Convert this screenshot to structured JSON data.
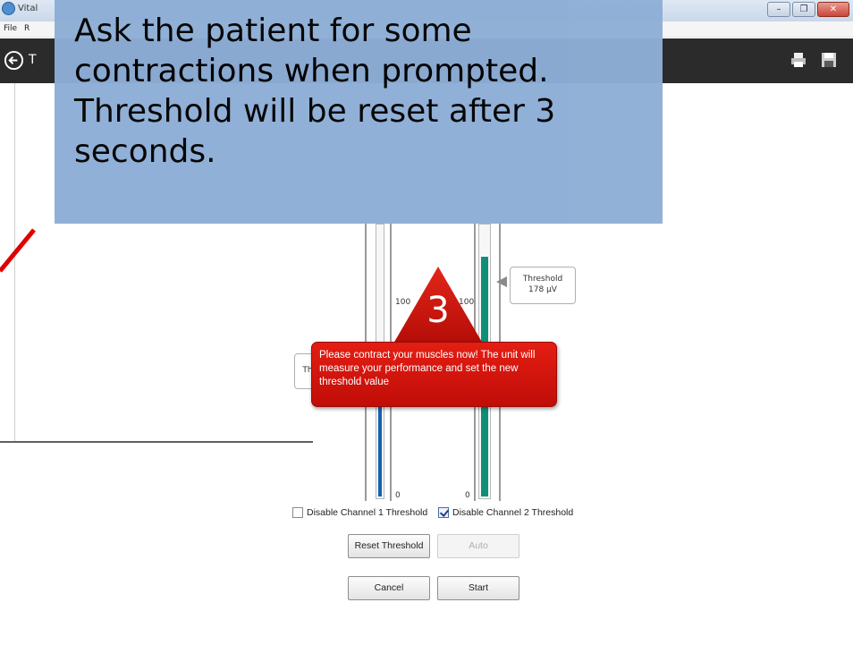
{
  "window": {
    "title": "Vital",
    "minimize": "–",
    "restore": "❐",
    "close": "✕"
  },
  "menu": {
    "file": "File",
    "second": "R"
  },
  "toolbar": {
    "title_fragment": "T"
  },
  "instruction": {
    "text": "Ask the patient for some contractions when prompted. Threshold will be reset after 3 seconds."
  },
  "channel1": {
    "scale_top": "100",
    "scale_bottom": "0",
    "callout_fragment": "Th",
    "fill_color": "#1a5fb4",
    "level_fraction": 0.42
  },
  "channel2": {
    "scale_top": "100",
    "scale_bottom": "0",
    "threshold_label": "Threshold",
    "threshold_value": "178 µV",
    "fill_color": "#0e8f78",
    "level_fraction": 0.88
  },
  "countdown": {
    "value": "3",
    "color": "#c8140c"
  },
  "prompt": {
    "text": "Please contract your muscles now! The unit will measure your performance and set the new threshold value"
  },
  "checkboxes": [
    {
      "label": "Disable Channel 1 Threshold",
      "checked": false
    },
    {
      "label": "Disable Channel 2 Threshold",
      "checked": true
    }
  ],
  "buttons": {
    "reset": "Reset Threshold",
    "auto": "Auto",
    "cancel": "Cancel",
    "start": "Start"
  },
  "icons": [
    "back-arrow-icon",
    "print-icon",
    "save-icon",
    "app-icon",
    "check-icon"
  ]
}
